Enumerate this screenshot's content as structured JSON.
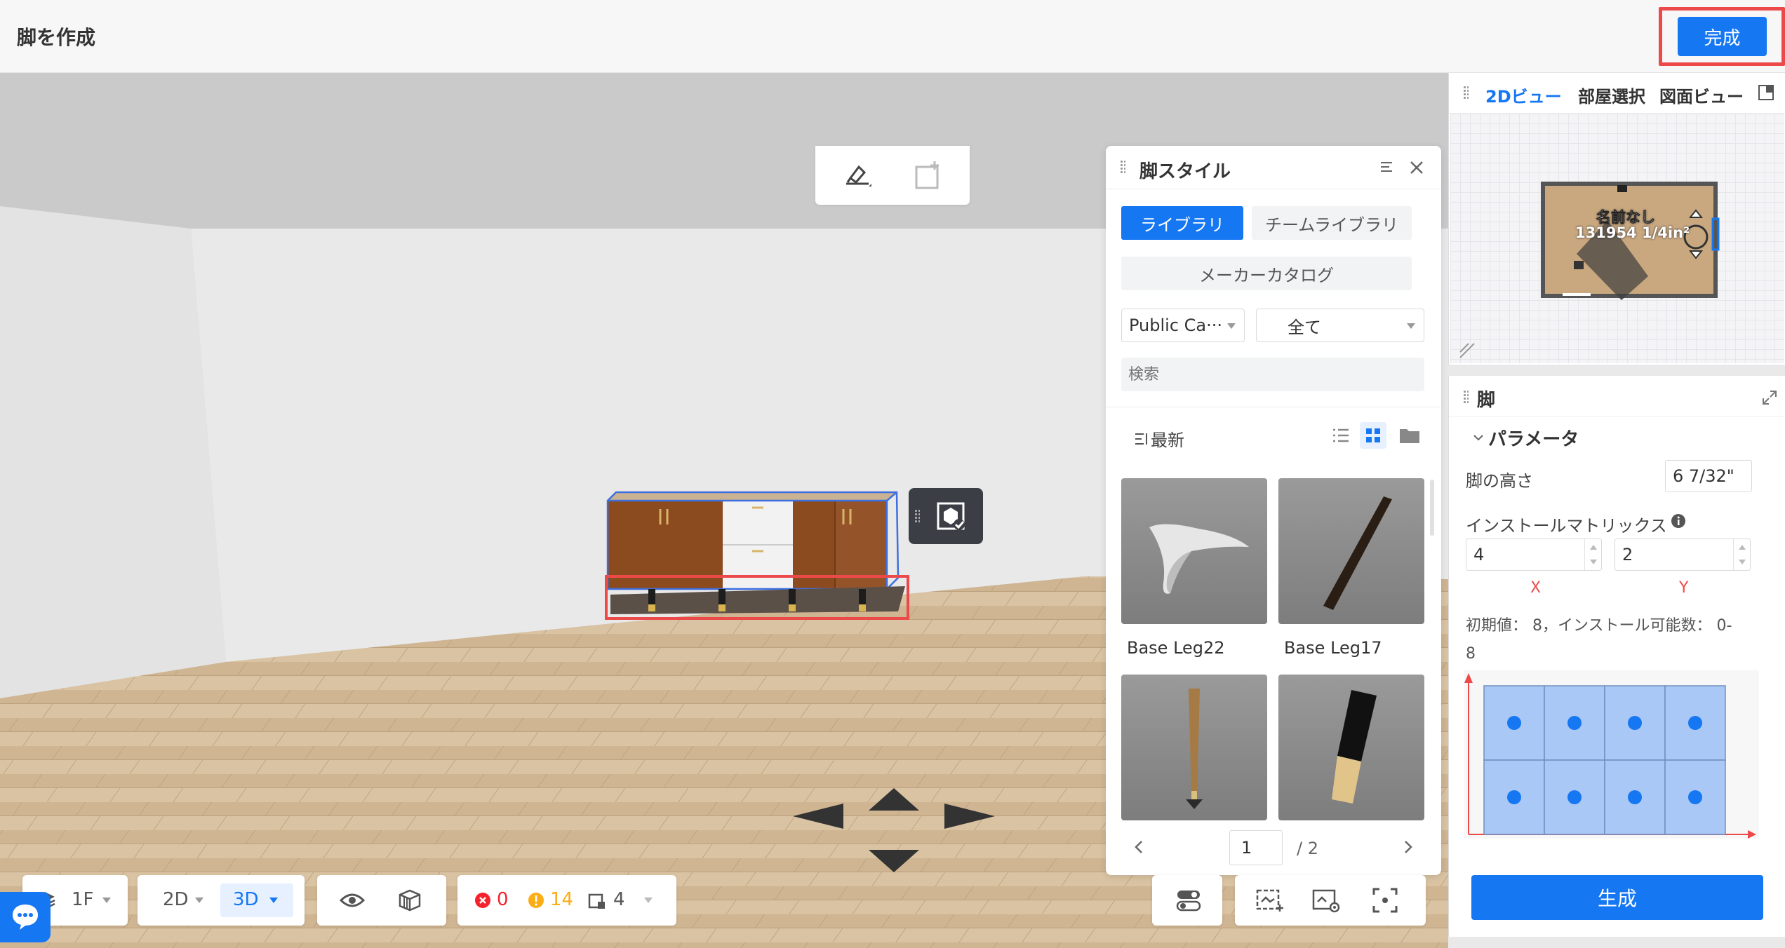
{
  "header": {
    "title": "脚を作成",
    "done_label": "完成"
  },
  "colors": {
    "accent": "#1677f2",
    "highlight": "#ec4a4a",
    "error": "#f5222d",
    "warning": "#faad14"
  },
  "leg_style_panel": {
    "title": "脚スタイル",
    "tabs": [
      "ライブラリ",
      "チームライブラリ"
    ],
    "maker_catalog_label": "メーカーカタログ",
    "category_select": "Public Ca···",
    "filter_select": "全て",
    "search_placeholder": "検索",
    "sort_label": "最新",
    "items": [
      {
        "name": "Base Leg22"
      },
      {
        "name": "Base Leg17"
      },
      {
        "name": ""
      },
      {
        "name": ""
      }
    ],
    "pagination": {
      "current": "1",
      "total": "/ 2"
    }
  },
  "plan_panel": {
    "tabs": [
      "2Dビュー",
      "部屋選択",
      "図面ビュー"
    ],
    "room_name": "名前なし",
    "room_area": "131954 1/4in²"
  },
  "leg_panel": {
    "title": "脚",
    "section": "パラメータ",
    "height_label": "脚の高さ",
    "height_value": "6 7/32\"",
    "matrix_label": "インストールマトリックス",
    "x_value": "4",
    "y_value": "2",
    "x_axis": "X",
    "y_axis": "Y",
    "hint": "初期値： 8，インストール可能数： 0-",
    "hint_tail": "8",
    "matrix": {
      "cols": 4,
      "rows": 2
    },
    "generate_label": "生成"
  },
  "bottom_bar": {
    "floor": "1F",
    "view_2d": "2D",
    "view_3d": "3D",
    "errors": "0",
    "warnings": "14",
    "items": "4"
  }
}
